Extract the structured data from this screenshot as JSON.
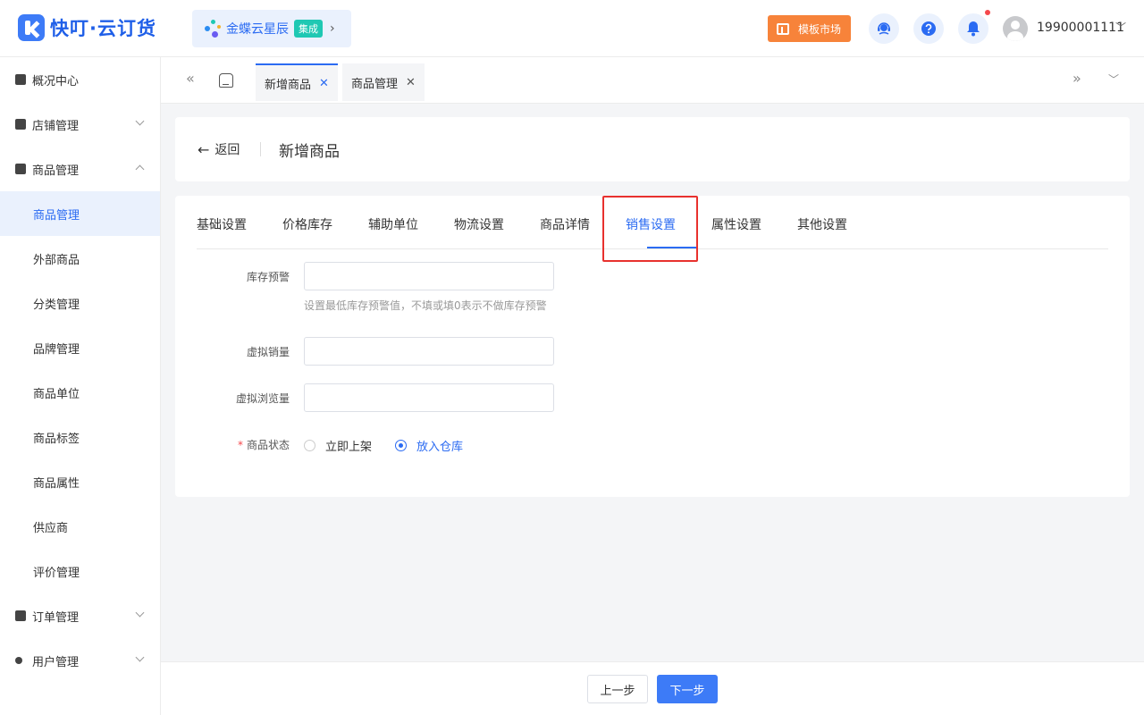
{
  "header": {
    "logo_text": "快叮·云订货",
    "partner": {
      "name": "金蝶云星辰",
      "badge": "集成"
    },
    "market_label": "模板市场",
    "username": "19900001111"
  },
  "sidebar": {
    "groups": [
      {
        "label": "概况中心"
      },
      {
        "label": "店铺管理"
      },
      {
        "label": "商品管理"
      },
      {
        "label": "订单管理"
      },
      {
        "label": "用户管理"
      }
    ],
    "items": [
      {
        "label": "商品管理"
      },
      {
        "label": "外部商品"
      },
      {
        "label": "分类管理"
      },
      {
        "label": "品牌管理"
      },
      {
        "label": "商品单位"
      },
      {
        "label": "商品标签"
      },
      {
        "label": "商品属性"
      },
      {
        "label": "供应商"
      },
      {
        "label": "评价管理"
      }
    ]
  },
  "page_tabs": [
    {
      "label": "新增商品"
    },
    {
      "label": "商品管理"
    }
  ],
  "page": {
    "back_label": "返回",
    "title": "新增商品"
  },
  "form_tabs": [
    {
      "label": "基础设置"
    },
    {
      "label": "价格库存"
    },
    {
      "label": "辅助单位"
    },
    {
      "label": "物流设置"
    },
    {
      "label": "商品详情"
    },
    {
      "label": "销售设置"
    },
    {
      "label": "属性设置"
    },
    {
      "label": "其他设置"
    }
  ],
  "form": {
    "stock_warning": {
      "label": "库存预警",
      "value": "",
      "hint": "设置最低库存预警值，不填或填0表示不做库存预警"
    },
    "virtual_sales": {
      "label": "虚拟销量",
      "value": ""
    },
    "virtual_views": {
      "label": "虚拟浏览量",
      "value": ""
    },
    "status": {
      "required_mark": "*",
      "label": "商品状态",
      "options": [
        {
          "label": "立即上架"
        },
        {
          "label": "放入仓库"
        }
      ],
      "selected": "放入仓库"
    }
  },
  "footer": {
    "prev_label": "上一步",
    "next_label": "下一步"
  },
  "colors": {
    "primary": "#2b6bf2",
    "highlight": "#e8312e",
    "market": "#f7833a"
  }
}
